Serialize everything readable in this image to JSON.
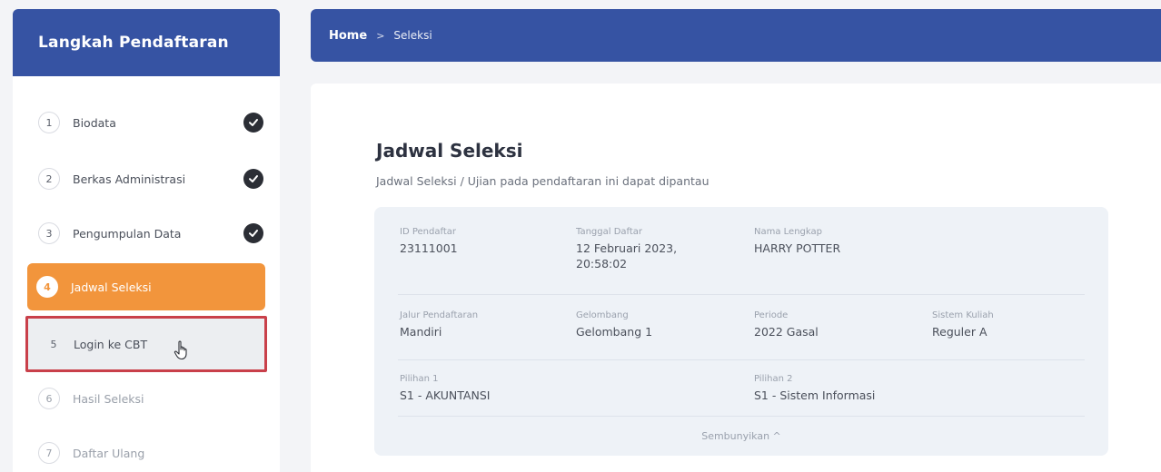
{
  "sidebar": {
    "title": "Langkah Pendaftaran",
    "steps": [
      {
        "num": "1",
        "label": "Biodata",
        "done": true
      },
      {
        "num": "2",
        "label": "Berkas Administrasi",
        "done": true
      },
      {
        "num": "3",
        "label": "Pengumpulan Data",
        "done": true
      },
      {
        "num": "4",
        "label": "Jadwal Seleksi",
        "active": true
      },
      {
        "num": "5",
        "label": "Login ke CBT",
        "highlighted": true
      },
      {
        "num": "6",
        "label": "Hasil Seleksi"
      },
      {
        "num": "7",
        "label": "Daftar Ulang"
      }
    ]
  },
  "breadcrumb": {
    "home": "Home",
    "separator": ">",
    "current": "Seleksi"
  },
  "main": {
    "title": "Jadwal Seleksi",
    "subtitle": "Jadwal Seleksi / Ujian pada pendaftaran ini dapat dipantau",
    "fields": {
      "id_pendaftar": {
        "label": "ID Pendaftar",
        "value": "23111001"
      },
      "tanggal_daftar": {
        "label": "Tanggal Daftar",
        "value_line1": "12 Februari 2023,",
        "value_line2": "20:58:02"
      },
      "nama_lengkap": {
        "label": "Nama Lengkap",
        "value": "HARRY POTTER"
      },
      "jalur": {
        "label": "Jalur Pendaftaran",
        "value": "Mandiri"
      },
      "gelombang": {
        "label": "Gelombang",
        "value": "Gelombang 1"
      },
      "periode": {
        "label": "Periode",
        "value": "2022 Gasal"
      },
      "sistem_kuliah": {
        "label": "Sistem Kuliah",
        "value": "Reguler A"
      },
      "pilihan1": {
        "label": "Pilihan 1",
        "value": "S1 - AKUNTANSI"
      },
      "pilihan2": {
        "label": "Pilihan 2",
        "value": "S1 - Sistem Informasi"
      }
    },
    "hide_link": "Sembunyikan ^"
  },
  "colors": {
    "primary": "#3653a3",
    "accent": "#f2953c",
    "highlight_border": "#c9404a"
  }
}
